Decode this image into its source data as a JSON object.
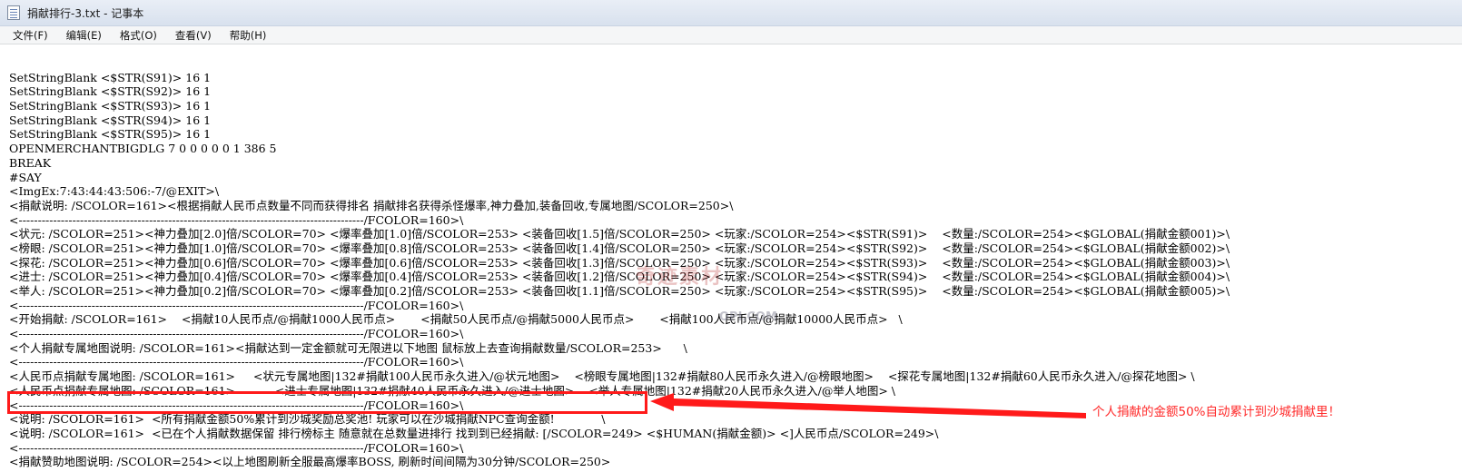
{
  "window": {
    "title": "捐献排行-3.txt - 记事本"
  },
  "menu": {
    "items": [
      "文件(F)",
      "编辑(E)",
      "格式(O)",
      "查看(V)",
      "帮助(H)"
    ]
  },
  "editor": {
    "lines": [
      "",
      "SetStringBlank <$STR(S91)> 16 1",
      "SetStringBlank <$STR(S92)> 16 1",
      "SetStringBlank <$STR(S93)> 16 1",
      "SetStringBlank <$STR(S94)> 16 1",
      "SetStringBlank <$STR(S95)> 16 1",
      "OPENMERCHANTBIGDLG 7 0 0 0 0 0 1 386 5",
      "BREAK",
      "#SAY",
      "<ImgEx:7:43:44:43:506:-7/@EXIT>\\",
      "<捐献说明: /SCOLOR=161><根据捐献人民币点数量不同而获得排名 捐献排名获得杀怪爆率,神力叠加,装备回收,专属地图/SCOLOR=250>\\",
      "<------------------------------------------------------------------------------------------/FCOLOR=160>\\",
      "<状元: /SCOLOR=251><神力叠加[2.0]倍/SCOLOR=70> <爆率叠加[1.0]倍/SCOLOR=253> <装备回收[1.5]倍/SCOLOR=250> <玩家:/SCOLOR=254><$STR(S91)>    <数量:/SCOLOR=254><$GLOBAL(捐献金额001)>\\",
      "<榜眼: /SCOLOR=251><神力叠加[1.0]倍/SCOLOR=70> <爆率叠加[0.8]倍/SCOLOR=253> <装备回收[1.4]倍/SCOLOR=250> <玩家:/SCOLOR=254><$STR(S92)>    <数量:/SCOLOR=254><$GLOBAL(捐献金额002)>\\",
      "<探花: /SCOLOR=251><神力叠加[0.6]倍/SCOLOR=70> <爆率叠加[0.6]倍/SCOLOR=253> <装备回收[1.3]倍/SCOLOR=250> <玩家:/SCOLOR=254><$STR(S93)>    <数量:/SCOLOR=254><$GLOBAL(捐献金额003)>\\",
      "<进士: /SCOLOR=251><神力叠加[0.4]倍/SCOLOR=70> <爆率叠加[0.4]倍/SCOLOR=253> <装备回收[1.2]倍/SCOLOR=250> <玩家:/SCOLOR=254><$STR(S94)>    <数量:/SCOLOR=254><$GLOBAL(捐献金额004)>\\",
      "<举人: /SCOLOR=251><神力叠加[0.2]倍/SCOLOR=70> <爆率叠加[0.2]倍/SCOLOR=253> <装备回收[1.1]倍/SCOLOR=250> <玩家:/SCOLOR=254><$STR(S95)>    <数量:/SCOLOR=254><$GLOBAL(捐献金额005)>\\",
      "<------------------------------------------------------------------------------------------/FCOLOR=160>\\",
      "<开始捐献: /SCOLOR=161>    <捐献10人民币点/@捐献1000人民币点>       <捐献50人民币点/@捐献5000人民币点>       <捐献100人民币点/@捐献10000人民币点>   \\",
      "<------------------------------------------------------------------------------------------/FCOLOR=160>\\",
      "<个人捐献专属地图说明: /SCOLOR=161><捐献达到一定金额就可无限进以下地图 鼠标放上去查询捐献数量/SCOLOR=253>      \\",
      "<------------------------------------------------------------------------------------------/FCOLOR=160>\\",
      "<人民币点捐献专属地图: /SCOLOR=161>     <状元专属地图|132#捐献100人民币永久进入/@状元地图>    <榜眼专属地图|132#捐献80人民币永久进入/@榜眼地图>    <探花专属地图|132#捐献60人民币永久进入/@探花地图> \\",
      "<人民币点捐献专属地图: /SCOLOR=161>           <进士专属地图|132#捐献40人民币永久进入/@进士地图>    <举人专属地图|132#捐献20人民币永久进入/@举人地图> \\",
      "<------------------------------------------------------------------------------------------/FCOLOR=160>\\",
      "<说明: /SCOLOR=161>  <所有捐献金额50%累计到沙城奖励总奖池! 玩家可以在沙城捐献NPC查询金额!             \\",
      "<说明: /SCOLOR=161>  <已在个人捐献数据保留 排行榜标主 随意就在总数量进排行 找到到已经捐献: [/SCOLOR=249> <$HUMAN(捐献金额)> <]人民币点/SCOLOR=249>\\",
      "<------------------------------------------------------------------------------------------/FCOLOR=160>\\",
      "<捐献赞助地图说明: /SCOLOR=254><以上地图刷新全服最高爆率BOSS, 刷新时间间隔为30分钟/SCOLOR=250>"
    ]
  },
  "annotation": {
    "text": "个人捐献的金额50%自动累计到沙城捐献里！",
    "color": "#ff2a2a"
  },
  "watermark": {
    "main": "奇迹素材",
    "sub": "OPI.COM"
  }
}
